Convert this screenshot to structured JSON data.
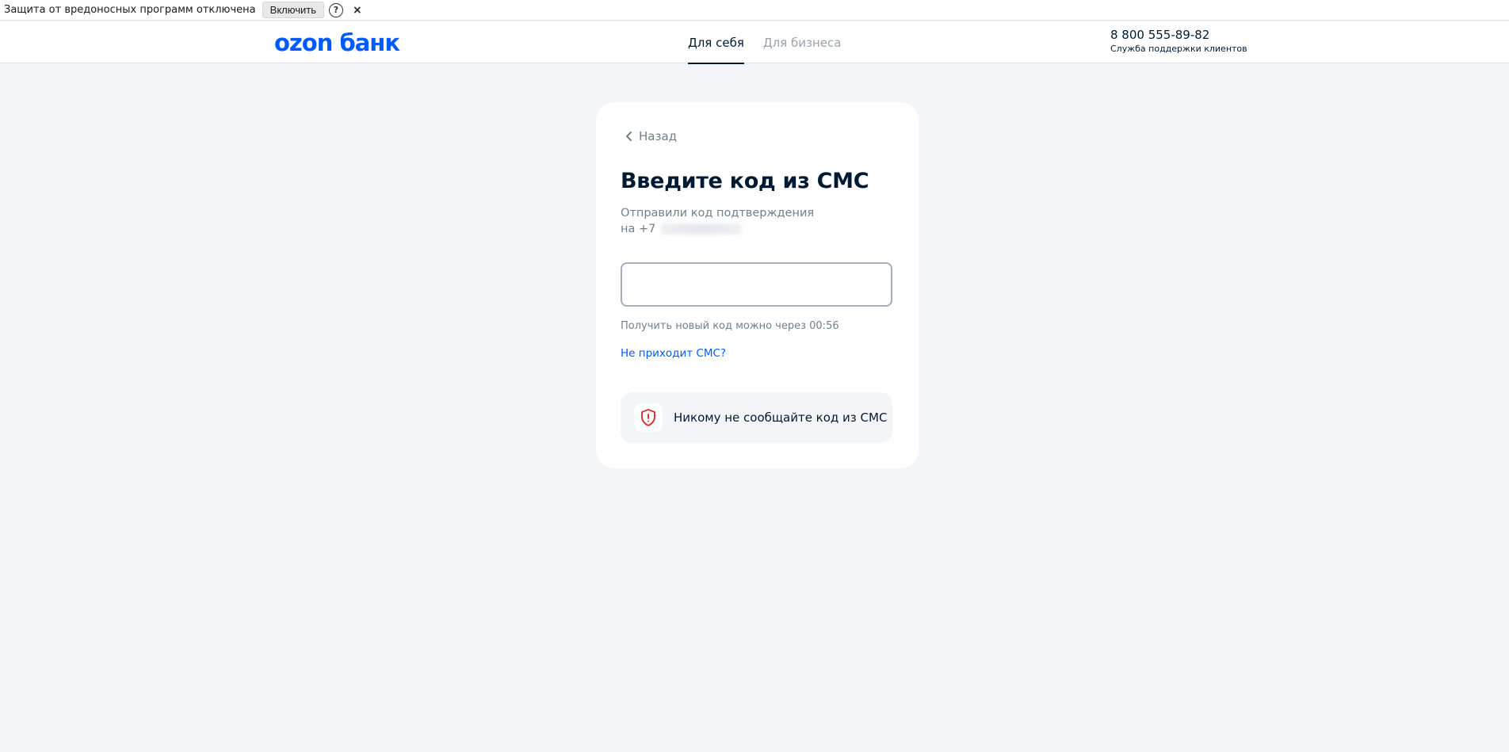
{
  "protection_bar": {
    "message": "Защита от вредоносных программ отключена",
    "enable_label": "Включить",
    "help_symbol": "?",
    "close_symbol": "×"
  },
  "header": {
    "logo": "ozon банк",
    "tabs": [
      {
        "label": "Для себя",
        "active": true
      },
      {
        "label": "Для бизнеса",
        "active": false
      }
    ],
    "support_phone": "8 800 555-89-82",
    "support_label": "Служба поддержки клиентов"
  },
  "card": {
    "back_label": "Назад",
    "title": "Введите код из СМС",
    "subtitle_line1": "Отправили код подтверждения",
    "subtitle_line2_prefix": "на +7",
    "code_input_value": "",
    "timer_text": "Получить новый код можно через 00:56",
    "no_sms_link": "Не приходит СМС?",
    "warning_text": "Никому не сообщайте код из СМС"
  },
  "colors": {
    "brand": "#005bff",
    "page_background": "#f4f5f8",
    "warning_icon": "#e2332d"
  },
  "icons": [
    "help-icon",
    "close-icon",
    "chevron-left-icon",
    "shield-alert-icon"
  ]
}
